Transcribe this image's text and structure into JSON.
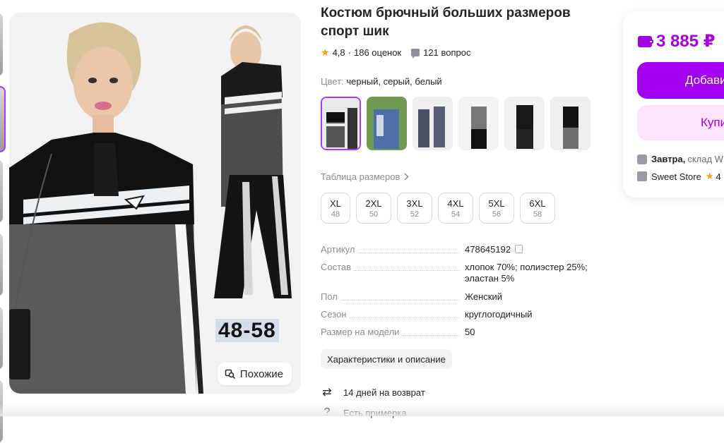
{
  "product": {
    "title": "Костюм брючный больших размеров спорт шик",
    "rating": "4,8",
    "reviews": "186 оценок",
    "questions": "121 вопрос",
    "separator": "·"
  },
  "gallery": {
    "size_overlay": "48-58",
    "similar_label": "Похожие"
  },
  "color": {
    "label": "Цвет:",
    "value": "черный, серый, белый"
  },
  "size_table_label": "Таблица размеров",
  "sizes": [
    {
      "label": "XL",
      "ru": "48"
    },
    {
      "label": "2XL",
      "ru": "50"
    },
    {
      "label": "3XL",
      "ru": "52"
    },
    {
      "label": "4XL",
      "ru": "54"
    },
    {
      "label": "5XL",
      "ru": "56"
    },
    {
      "label": "6XL",
      "ru": "58"
    }
  ],
  "specs": [
    {
      "key": "Артикул",
      "value": "478645192"
    },
    {
      "key": "Состав",
      "value": "хлопок 70%; полиэстер 25%; эластан 5%"
    },
    {
      "key": "Пол",
      "value": "Женский"
    },
    {
      "key": "Сезон",
      "value": "круглогодичный"
    },
    {
      "key": "Размер на модели",
      "value": "50"
    }
  ],
  "description_button": "Характеристики и описание",
  "services": [
    {
      "label": "14 дней на возврат",
      "icon": "return-arrows-icon"
    },
    {
      "label": "Есть примерка",
      "icon": "hanger-icon"
    }
  ],
  "price_card": {
    "price": "3 885 ₽",
    "add_button": "Добавить",
    "buy_button": "Купить",
    "delivery_day": "Завтра,",
    "delivery_rest": "склад W",
    "store_name": "Sweet Store",
    "store_rating": "4"
  },
  "colors": {
    "accent": "#a300f0",
    "accent_light": "#fbe3fb",
    "star": "#ff9d00",
    "muted": "#8b8b98"
  }
}
